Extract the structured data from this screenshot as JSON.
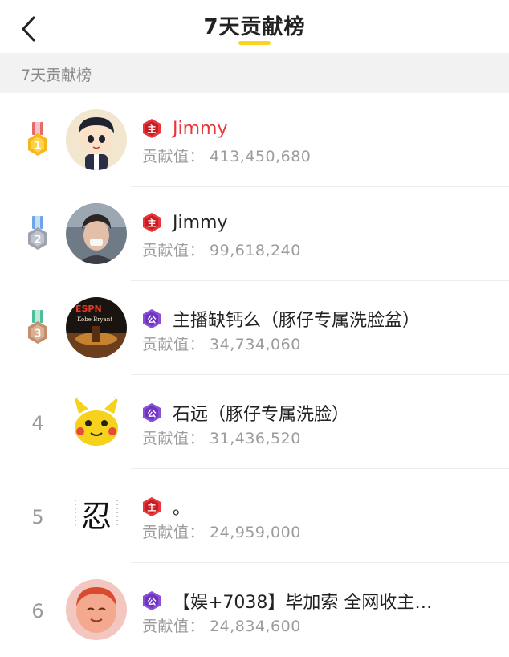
{
  "header": {
    "title": "7天贡献榜"
  },
  "section": {
    "label": "7天贡献榜"
  },
  "value_prefix": "贡献值：",
  "colors": {
    "accent": "#FFD21E",
    "first_name": "#E8363B",
    "gold": "#F5B71E",
    "silver": "#A9AEB8",
    "bronze": "#C99A7A",
    "anchor_badge": "#E8363B",
    "guild_badge": "#8C4FD8"
  },
  "entries": [
    {
      "rank": "1",
      "rank_icon": "gold-medal-icon",
      "badge": "主",
      "badge_icon": "anchor-badge-icon",
      "name": "Jimmy",
      "value": "413,450,680"
    },
    {
      "rank": "2",
      "rank_icon": "silver-medal-icon",
      "badge": "主",
      "badge_icon": "anchor-badge-icon",
      "name": "Jimmy",
      "value": "99,618,240"
    },
    {
      "rank": "3",
      "rank_icon": "bronze-medal-icon",
      "badge": "公",
      "badge_icon": "guild-badge-icon",
      "name": "主播缺钙么（豚仔专属洗脸盆）",
      "value": "34,734,060"
    },
    {
      "rank": "4",
      "badge": "公",
      "badge_icon": "guild-badge-icon",
      "name": "石远（豚仔专属洗脸）",
      "value": "31,436,520"
    },
    {
      "rank": "5",
      "badge": "主",
      "badge_icon": "anchor-badge-icon",
      "name": "。",
      "value": "24,959,000"
    },
    {
      "rank": "6",
      "badge": "公",
      "badge_icon": "guild-badge-icon",
      "name": "【娱+7038】毕加索 全网收主…",
      "value": "24,834,600"
    }
  ],
  "avatars": {
    "row3_logo_text": "ESPN",
    "row3_caption": "Kobe Bryant",
    "row5_glyph": "忍"
  }
}
